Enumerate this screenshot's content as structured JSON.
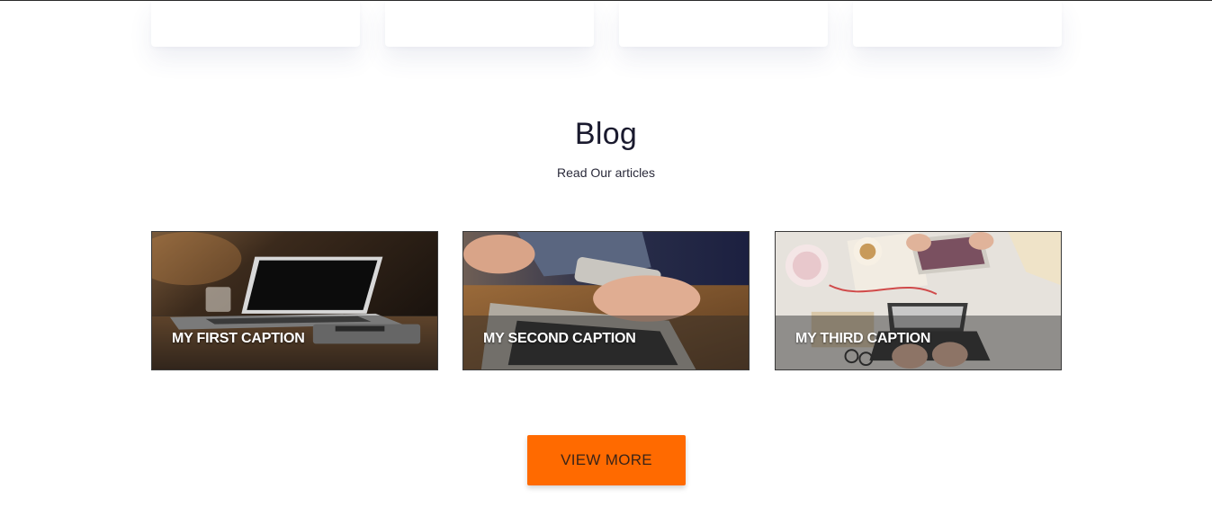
{
  "blog": {
    "title": "Blog",
    "subtitle": "Read Our articles"
  },
  "posts": [
    {
      "caption": "MY FIRST CAPTION"
    },
    {
      "caption": "MY SECOND CAPTION"
    },
    {
      "caption": "MY THIRD CAPTION"
    }
  ],
  "view_more_label": "VIEW MORE",
  "colors": {
    "accent": "#ff6a00",
    "title": "#1a1a2e"
  }
}
